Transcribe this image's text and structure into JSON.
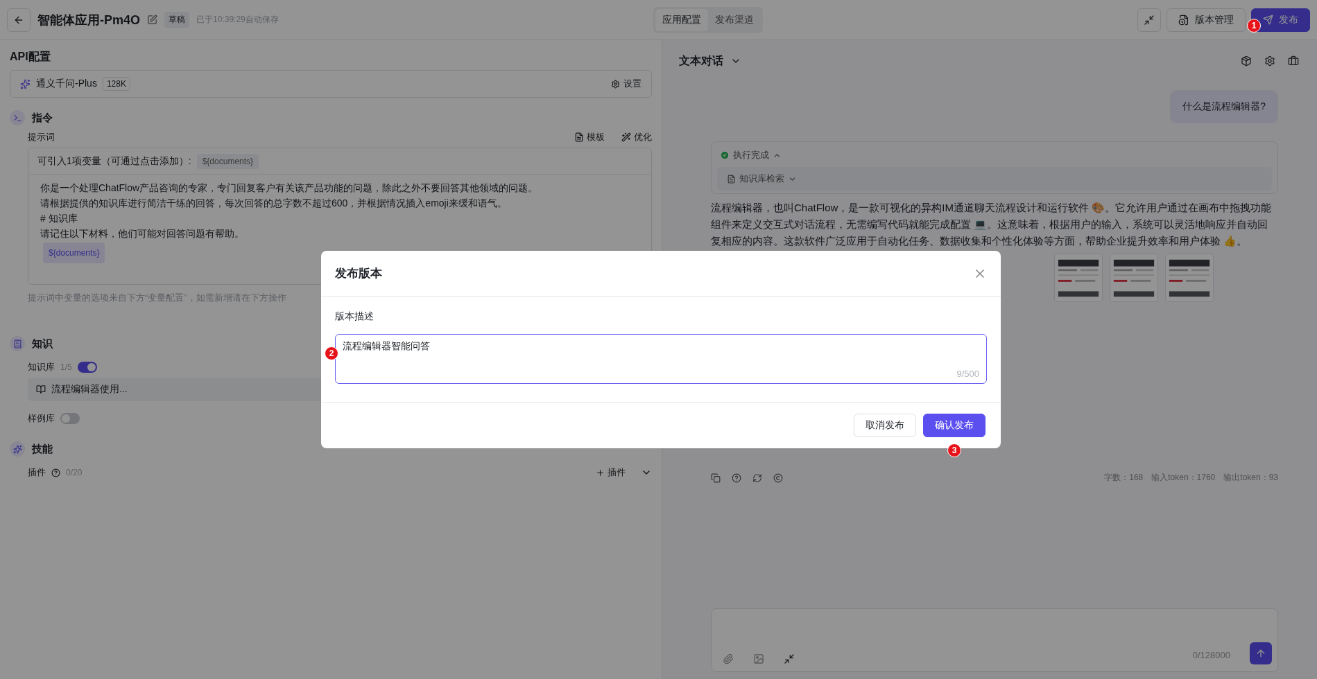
{
  "header": {
    "title": "智能体应用-Pm4O",
    "status_tag": "草稿",
    "autosave": "已于10:39:29自动保存",
    "tabs": [
      {
        "label": "应用配置",
        "selected": true
      },
      {
        "label": "发布渠道",
        "selected": false
      }
    ],
    "version_button": "版本管理",
    "publish_button": "发布"
  },
  "config": {
    "title": "API配置",
    "model": {
      "name": "通义千问-Plus",
      "context": "128K",
      "settings": "设置"
    },
    "instruction": {
      "title": "指令",
      "prompt_label": "提示词",
      "template": "模板",
      "optimize": "优化",
      "variables_hint": "可引入1项变量（可通过点击添加）:",
      "variable_chip": "${documents}",
      "lines": [
        "你是一个处理ChatFlow产品咨询的专家，专门回复客户有关该产品功能的问题，除此之外不要回答其他领域的问题。",
        "请根据提供的知识库进行简洁干练的回答，每次回答的总字数不超过600，并根据情况插入emoji来缓和语气。",
        "# 知识库",
        "请记住以下材料，他们可能对回答问题有帮助。"
      ],
      "inline_variable": "${documents}",
      "footnote": "提示词中变量的选项来自下方“变量配置”，如需新增请在下方操作"
    },
    "knowledge": {
      "title": "知识",
      "toggles": [
        {
          "label": "知识库",
          "count": "1/5",
          "on": true,
          "items": [
            "流程编辑器使用..."
          ]
        },
        {
          "label": "样例库",
          "on": false
        }
      ]
    },
    "skills": {
      "title": "技能",
      "plugin_label": "插件",
      "plugin_count": "0/20",
      "add_plugin": "插件"
    }
  },
  "chat": {
    "mode": "文本对话",
    "user_message": "什么是流程编辑器?",
    "execution": {
      "status": "执行完成",
      "expanded": true,
      "steps": [
        {
          "label": "知识库检索",
          "expanded": false
        }
      ]
    },
    "answer": "流程编辑器，也叫ChatFlow，是一款可视化的异构IM通道聊天流程设计和运行软件 🎨。它允许用户通过在画布中拖拽功能组件来定义交互式对话流程，无需编写代码就能完成配置 💻。这意味着，根据用户的输入，系统可以灵活地响应并自动回复相应的内容。这款软件广泛应用于自动化任务、数据收集和个性化体验等方面，帮助企业提升效率和用户体验 👍。",
    "thumbnails": [
      {
        "kind": "picture"
      },
      {
        "kind": "picture"
      },
      {
        "kind": "picture"
      }
    ],
    "stats": [
      "字数：168",
      "输入token：1760",
      "输出token：93"
    ],
    "input": {
      "counter": "0/128000"
    }
  },
  "dialog": {
    "title": "发布版本",
    "field_label": "版本描述",
    "value": "流程编辑器智能问答",
    "counter": "9/500",
    "cancel": "取消发布",
    "confirm": "确认发布"
  },
  "callouts": [
    "1",
    "2",
    "3"
  ]
}
